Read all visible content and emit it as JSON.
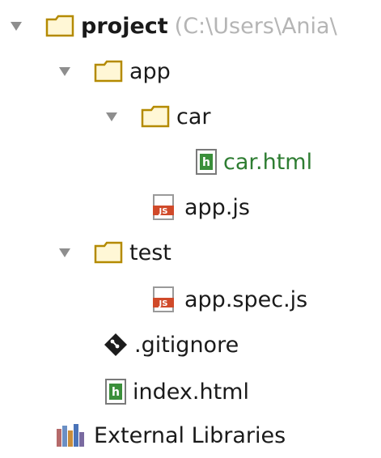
{
  "tree": {
    "root": {
      "label": "project",
      "path": "(C:\\Users\\Ania\\"
    },
    "app_folder": "app",
    "car_folder": "car",
    "car_file": "car.html",
    "app_js": "app.js",
    "test_folder": "test",
    "app_spec": "app.spec.js",
    "gitignore": ".gitignore",
    "index_file": "index.html",
    "external_libraries": "External Libraries"
  },
  "colors": {
    "folder_outline": "#b48a00",
    "folder_fill": "#fff7d6",
    "html_icon": "#3a8f3a",
    "js_icon": "#d04a2a",
    "arrow": "#8e8e8e",
    "green_text": "#2e7d32"
  },
  "icons": {
    "expand": "triangle-down-icon",
    "folder": "folder-icon",
    "html": "html-file-icon",
    "js": "js-file-icon",
    "git": "git-diamond-icon",
    "libraries": "library-books-icon"
  }
}
